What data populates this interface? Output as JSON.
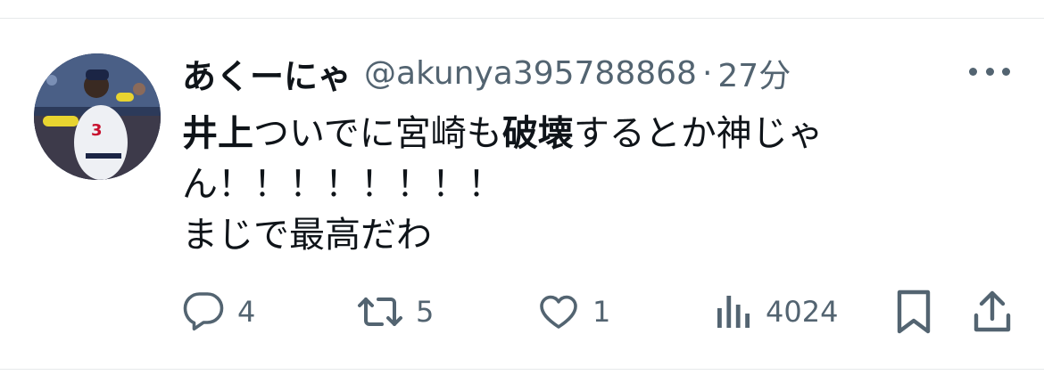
{
  "tweet": {
    "author_name": "あくーにゃ",
    "handle": "@akunya395788868",
    "separator": "·",
    "time": "27分",
    "text": {
      "line1_bold_a": "井上",
      "line1_a": "ついでに宮崎も",
      "line1_bold_b": "破壊",
      "line1_b": "するとか神じゃ",
      "line2": "ん！！！！！！！！",
      "line3": "まじで最高だわ"
    }
  },
  "actions": {
    "reply_count": "4",
    "retweet_count": "5",
    "like_count": "1",
    "views_count": "4024"
  },
  "icons": {
    "reply": "reply-icon",
    "retweet": "retweet-icon",
    "like": "heart-icon",
    "views": "views-icon",
    "bookmark": "bookmark-icon",
    "share": "share-icon",
    "more": "more-icon"
  },
  "colors": {
    "text": "#0f1419",
    "secondary": "#536471",
    "divider": "#e6e9eb"
  }
}
